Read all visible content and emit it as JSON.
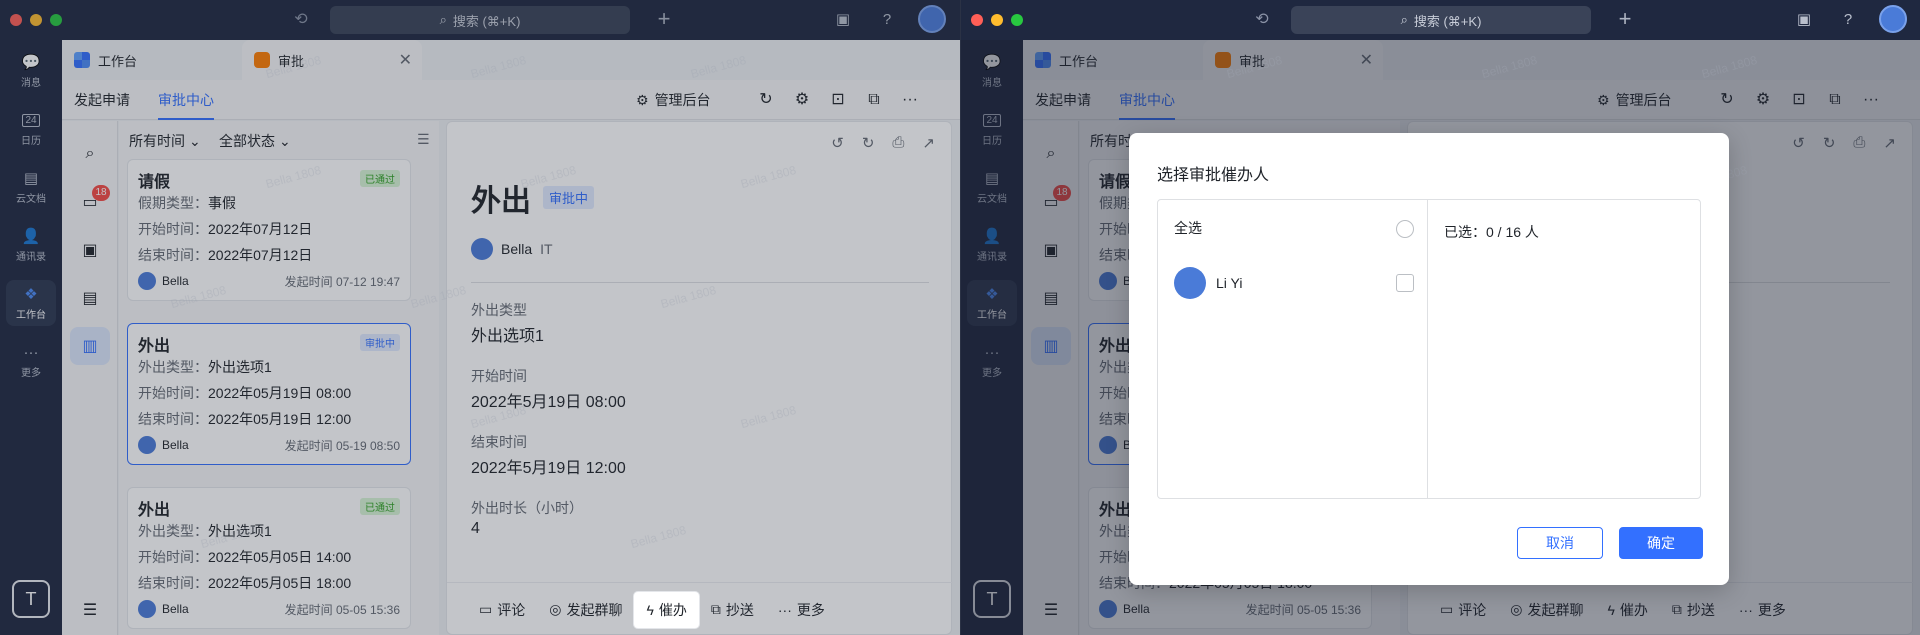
{
  "search": {
    "placeholder": "搜索 (⌘+K)"
  },
  "rail": {
    "items": [
      {
        "label": "消息",
        "icon": "chat-icon"
      },
      {
        "label": "日历",
        "icon": "calendar-icon",
        "date": "24"
      },
      {
        "label": "云文档",
        "icon": "doc-icon"
      },
      {
        "label": "通讯录",
        "icon": "contacts-icon"
      },
      {
        "label": "工作台",
        "icon": "workplace-icon"
      },
      {
        "label": "更多",
        "icon": "more-icon"
      }
    ],
    "workspace_letter": "T"
  },
  "tabs": [
    {
      "label": "工作台"
    },
    {
      "label": "审批"
    }
  ],
  "subnav": {
    "tab1": "发起申请",
    "tab2": "审批中心",
    "admin": "管理后台"
  },
  "inner_rail": {
    "badge": "18"
  },
  "filters": {
    "time": "所有时间",
    "status": "全部状态"
  },
  "cards": [
    {
      "title": "请假",
      "status": "已通过",
      "rows": [
        {
          "k": "假期类型：",
          "v": "事假"
        },
        {
          "k": "开始时间：",
          "v": "2022年07月12日"
        },
        {
          "k": "结束时间：",
          "v": "2022年07月12日"
        }
      ],
      "person": "Bella",
      "time": "发起时间 07-12 19:47"
    },
    {
      "title": "外出",
      "status": "审批中",
      "rows": [
        {
          "k": "外出类型：",
          "v": "外出选项1"
        },
        {
          "k": "开始时间：",
          "v": "2022年05月19日 08:00"
        },
        {
          "k": "结束时间：",
          "v": "2022年05月19日 12:00"
        }
      ],
      "person": "Bella",
      "time": "发起时间 05-19 08:50"
    },
    {
      "title": "外出",
      "status": "已通过",
      "rows": [
        {
          "k": "外出类型：",
          "v": "外出选项1"
        },
        {
          "k": "开始时间：",
          "v": "2022年05月05日 14:00"
        },
        {
          "k": "结束时间：",
          "v": "2022年05月05日 18:00"
        }
      ],
      "person": "Bella",
      "time": "发起时间 05-05 15:36"
    }
  ],
  "detail": {
    "title": "外出",
    "status": "审批中",
    "person": "Bella",
    "dept": "IT",
    "fields": [
      {
        "label": "外出类型",
        "value": "外出选项1"
      },
      {
        "label": "开始时间",
        "value": "2022年5月19日 08:00"
      },
      {
        "label": "结束时间",
        "value": "2022年5月19日 12:00"
      },
      {
        "label": "外出时长（小时）",
        "value": "4"
      }
    ],
    "actions": [
      "评论",
      "发起群聊",
      "催办",
      "抄送",
      "更多"
    ]
  },
  "modal": {
    "title": "选择审批催办人",
    "select_all": "全选",
    "person": "Li Yi",
    "selected": "已选：0 / 16 人",
    "cancel": "取消",
    "ok": "确定"
  },
  "watermark": "Bella 1808",
  "colors": {
    "accent": "#3370ff",
    "rail": "#1f2840",
    "badge": "#f54a45"
  }
}
